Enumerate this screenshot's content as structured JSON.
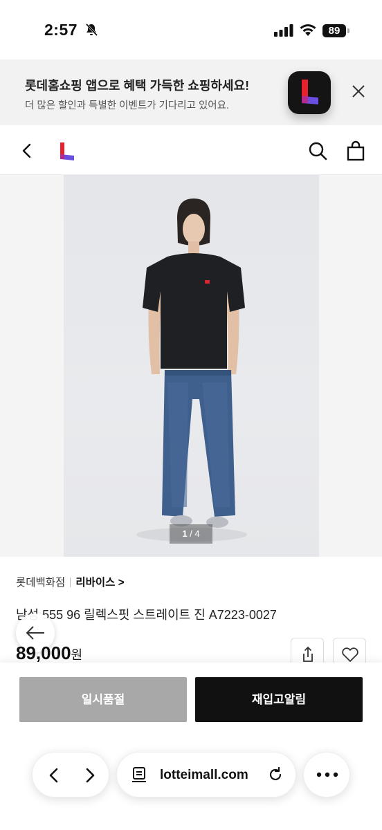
{
  "status_bar": {
    "time": "2:57",
    "battery": "89"
  },
  "app_banner": {
    "title": "롯데홈쇼핑 앱으로 혜택 가득한 쇼핑하세요!",
    "subtitle": "더 많은 할인과 특별한 이벤트가 기다리고 있어요."
  },
  "product": {
    "image_pager": {
      "current": "1",
      "separator": " / ",
      "total": "4"
    },
    "store": "롯데백화점",
    "brand": "리바이스 >",
    "name": "남성 555 96 릴렉스핏 스트레이트 진 A7223-0027",
    "price": "89,000",
    "price_unit": "원"
  },
  "actions": {
    "soldout_label": "일시품절",
    "restock_label": "재입고알림"
  },
  "browser": {
    "url": "lotteimall.com"
  },
  "colors": {
    "brand_red": "#e8212e",
    "brand_purple": "#6b4fe0",
    "button_black": "#111111",
    "button_gray": "#a8a8a8"
  }
}
